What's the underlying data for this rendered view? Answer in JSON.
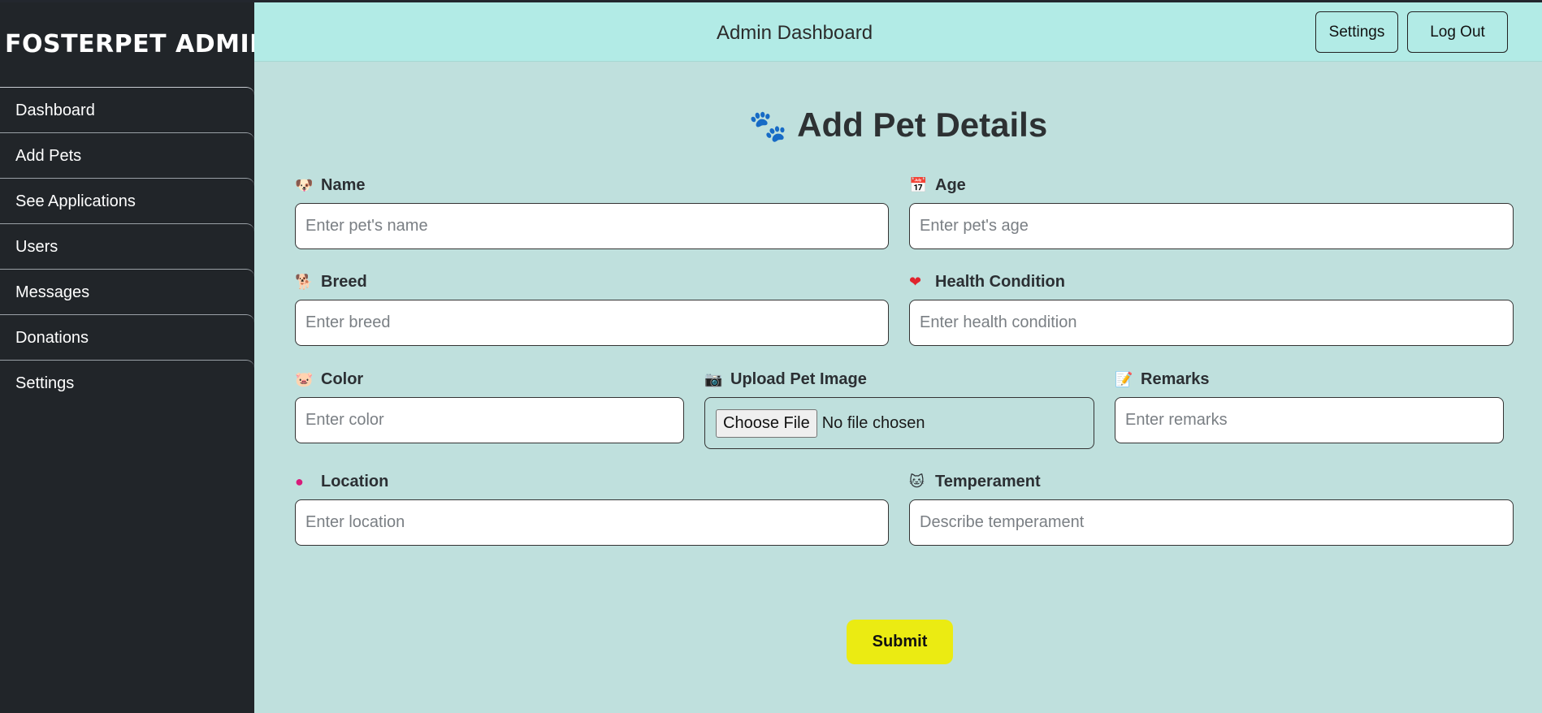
{
  "sidebar": {
    "brand": "FOSTERPET ADMIN",
    "items": [
      {
        "label": "Dashboard"
      },
      {
        "label": "Add Pets"
      },
      {
        "label": "See Applications"
      },
      {
        "label": "Users"
      },
      {
        "label": "Messages"
      },
      {
        "label": "Donations"
      },
      {
        "label": "Settings"
      }
    ]
  },
  "header": {
    "title": "Admin Dashboard",
    "settings_label": "Settings",
    "logout_label": "Log Out"
  },
  "form": {
    "title": "Add Pet Details",
    "name": {
      "label": "Name",
      "placeholder": "Enter pet's name",
      "icon": "dog-face-icon"
    },
    "age": {
      "label": "Age",
      "placeholder": "Enter pet's age",
      "icon": "calendar-icon"
    },
    "breed": {
      "label": "Breed",
      "placeholder": "Enter breed",
      "icon": "dog-icon"
    },
    "health": {
      "label": "Health Condition",
      "placeholder": "Enter health condition",
      "icon": "heart-icon"
    },
    "color": {
      "label": "Color",
      "placeholder": "Enter color",
      "icon": "pig-icon"
    },
    "image": {
      "label": "Upload Pet Image",
      "button": "Choose File",
      "status": "No file chosen",
      "icon": "camera-icon"
    },
    "remarks": {
      "label": "Remarks",
      "placeholder": "Enter remarks",
      "icon": "memo-icon"
    },
    "location": {
      "label": "Location",
      "placeholder": "Enter location",
      "icon": "pin-icon"
    },
    "temperament": {
      "label": "Temperament",
      "placeholder": "Describe temperament",
      "icon": "cat-face-icon"
    },
    "submit_label": "Submit"
  },
  "colors": {
    "sidebar_bg": "#212529",
    "header_bg": "#b2ebe6",
    "content_bg": "#bfe0dd",
    "submit_bg": "#ebeb12"
  }
}
